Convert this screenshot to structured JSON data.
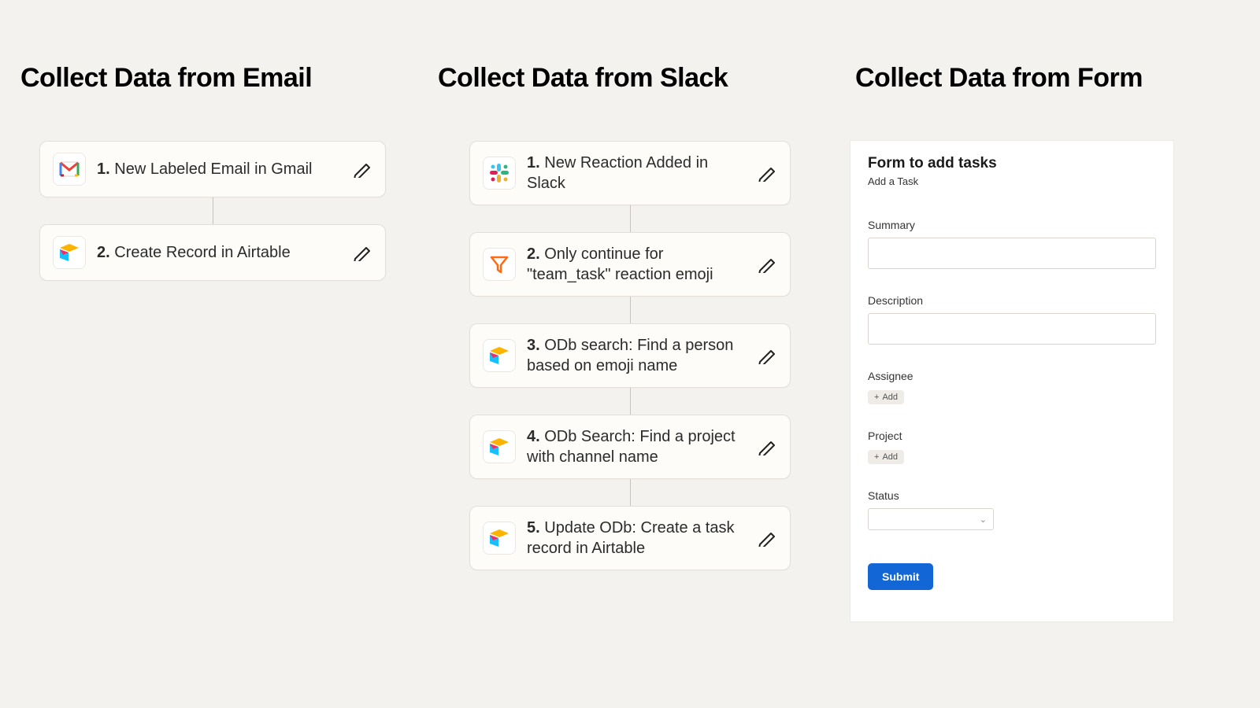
{
  "columns": {
    "email": {
      "title": "Collect Data from Email",
      "steps": [
        {
          "n": "1.",
          "label": "New Labeled Email in Gmail",
          "icon": "gmail"
        },
        {
          "n": "2.",
          "label": "Create Record in Airtable",
          "icon": "airtable"
        }
      ]
    },
    "slack": {
      "title": "Collect Data from Slack",
      "steps": [
        {
          "n": "1.",
          "label": "New Reaction Added in Slack",
          "icon": "slack"
        },
        {
          "n": "2.",
          "label": "Only continue for \"team_task\" reaction emoji",
          "icon": "filter"
        },
        {
          "n": "3.",
          "label": "ODb search: Find a person based on emoji name",
          "icon": "airtable"
        },
        {
          "n": "4.",
          "label": "ODb Search: Find a project with channel name",
          "icon": "airtable"
        },
        {
          "n": "5.",
          "label": "Update ODb: Create a task record in Airtable",
          "icon": "airtable"
        }
      ]
    },
    "form": {
      "title": "Collect Data from Form",
      "panel": {
        "heading": "Form to add tasks",
        "sub": "Add a Task",
        "fields": {
          "summary": "Summary",
          "description": "Description",
          "assignee": "Assignee",
          "project": "Project",
          "status": "Status"
        },
        "add_label": "Add",
        "submit": "Submit"
      }
    }
  }
}
